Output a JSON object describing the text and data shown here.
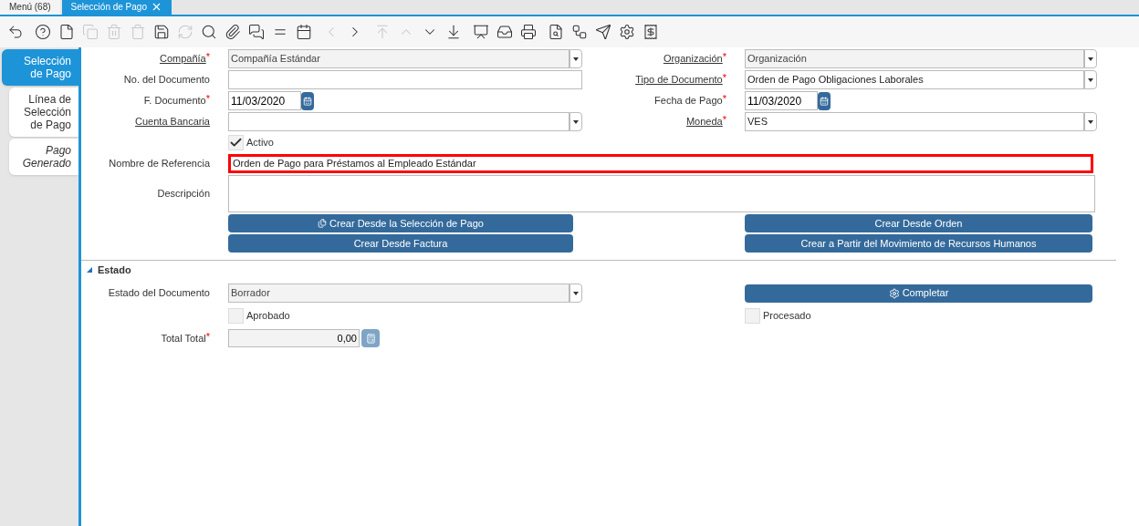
{
  "window_tabs": [
    {
      "label": "Menú (68)",
      "selected": false,
      "closable": false
    },
    {
      "label": "Selección de Pago",
      "selected": true,
      "closable": true
    }
  ],
  "toolbar": [
    {
      "disabled": false
    },
    {
      "disabled": false
    },
    {
      "disabled": false
    },
    {
      "disabled": true
    },
    {
      "disabled": true
    },
    {
      "disabled": true
    },
    {
      "disabled": false
    },
    {
      "disabled": true
    },
    {
      "disabled": false
    },
    {
      "disabled": false
    },
    {
      "disabled": false
    },
    {
      "disabled": false
    },
    {
      "disabled": false
    },
    {
      "disabled": true
    },
    {
      "disabled": false
    },
    {
      "disabled": true
    },
    {
      "disabled": true
    },
    {
      "disabled": false
    },
    {
      "disabled": false
    },
    {
      "disabled": false
    },
    {
      "disabled": false
    },
    {
      "disabled": false
    },
    {
      "disabled": false
    },
    {
      "disabled": false
    },
    {
      "disabled": false
    },
    {
      "disabled": false
    },
    {
      "disabled": false
    }
  ],
  "side_tabs": [
    {
      "label": "Selección de Pago",
      "selected": true,
      "empty": false
    },
    {
      "label": "Línea de Selección de Pago",
      "selected": false,
      "empty": false
    },
    {
      "label": "Pago Generado",
      "selected": false,
      "empty": true
    }
  ],
  "form_rows": [
    {
      "cells": [
        {
          "label": "Compañía",
          "required": "*",
          "link": true,
          "kind": "select",
          "value": "Compañía Estándar",
          "readonly": true
        },
        {
          "label": "Organización",
          "required": "*",
          "link": true,
          "kind": "select",
          "value": "Organización",
          "readonly": true
        }
      ]
    },
    {
      "cells": [
        {
          "label": "No. del Documento",
          "link": false,
          "kind": "text"
        },
        {
          "label": "Tipo de Documento",
          "required": "*",
          "link": true,
          "kind": "select",
          "value": "Orden de Pago Obligaciones Laborales",
          "readonly": false
        }
      ]
    },
    {
      "cells": [
        {
          "label": "F. Documento",
          "required": "*",
          "link": false,
          "kind": "date",
          "value": "11/03/2020"
        },
        {
          "label": "Fecha de Pago",
          "required": "*",
          "link": false,
          "kind": "date",
          "value": "11/03/2020"
        }
      ]
    },
    {
      "cells": [
        {
          "label": "Cuenta Bancaria",
          "link": true,
          "kind": "select",
          "readonly": false
        },
        {
          "label": "Moneda",
          "required": "*",
          "link": true,
          "kind": "select",
          "value": "VES",
          "readonly": false
        }
      ]
    },
    {
      "cells": [
        {
          "kind": "checkbox",
          "label": "Activo",
          "checked": true
        }
      ]
    },
    {
      "cells": [
        {
          "label": "Nombre de Referencia",
          "link": false,
          "kind": "wide",
          "value": "Orden de Pago para Préstamos al Empleado Estándar",
          "highlighted": true
        }
      ]
    },
    {
      "cells": [
        {
          "label": "Descripción",
          "link": false,
          "kind": "textarea"
        }
      ]
    },
    {
      "cells": [
        {
          "kind": "icon_button",
          "label": "Crear Desde la Selección de Pago"
        },
        {
          "kind": "button",
          "label": "Crear Desde Orden"
        }
      ]
    },
    {
      "cells": [
        {
          "kind": "button",
          "label": "Crear Desde Factura"
        },
        {
          "kind": "button",
          "label": "Crear a Partir del Movimiento de Recursos Humanos"
        }
      ]
    }
  ],
  "section": {
    "title": "Estado",
    "expanded": true
  },
  "status_rows": [
    {
      "cells": [
        {
          "label": "Estado del Documento",
          "link": false,
          "kind": "select",
          "value": "Borrador",
          "readonly": true
        },
        {
          "kind": "icon_button",
          "label": "Completar"
        }
      ]
    },
    {
      "cells": [
        {
          "kind": "checkbox",
          "label": "Aprobado",
          "checked": false
        },
        {
          "kind": "checkbox",
          "label": "Procesado",
          "checked": false
        }
      ]
    },
    {
      "cells": [
        {
          "label": "Total Total",
          "required": "*",
          "link": false,
          "kind": "number",
          "value": "0,00"
        }
      ]
    }
  ]
}
